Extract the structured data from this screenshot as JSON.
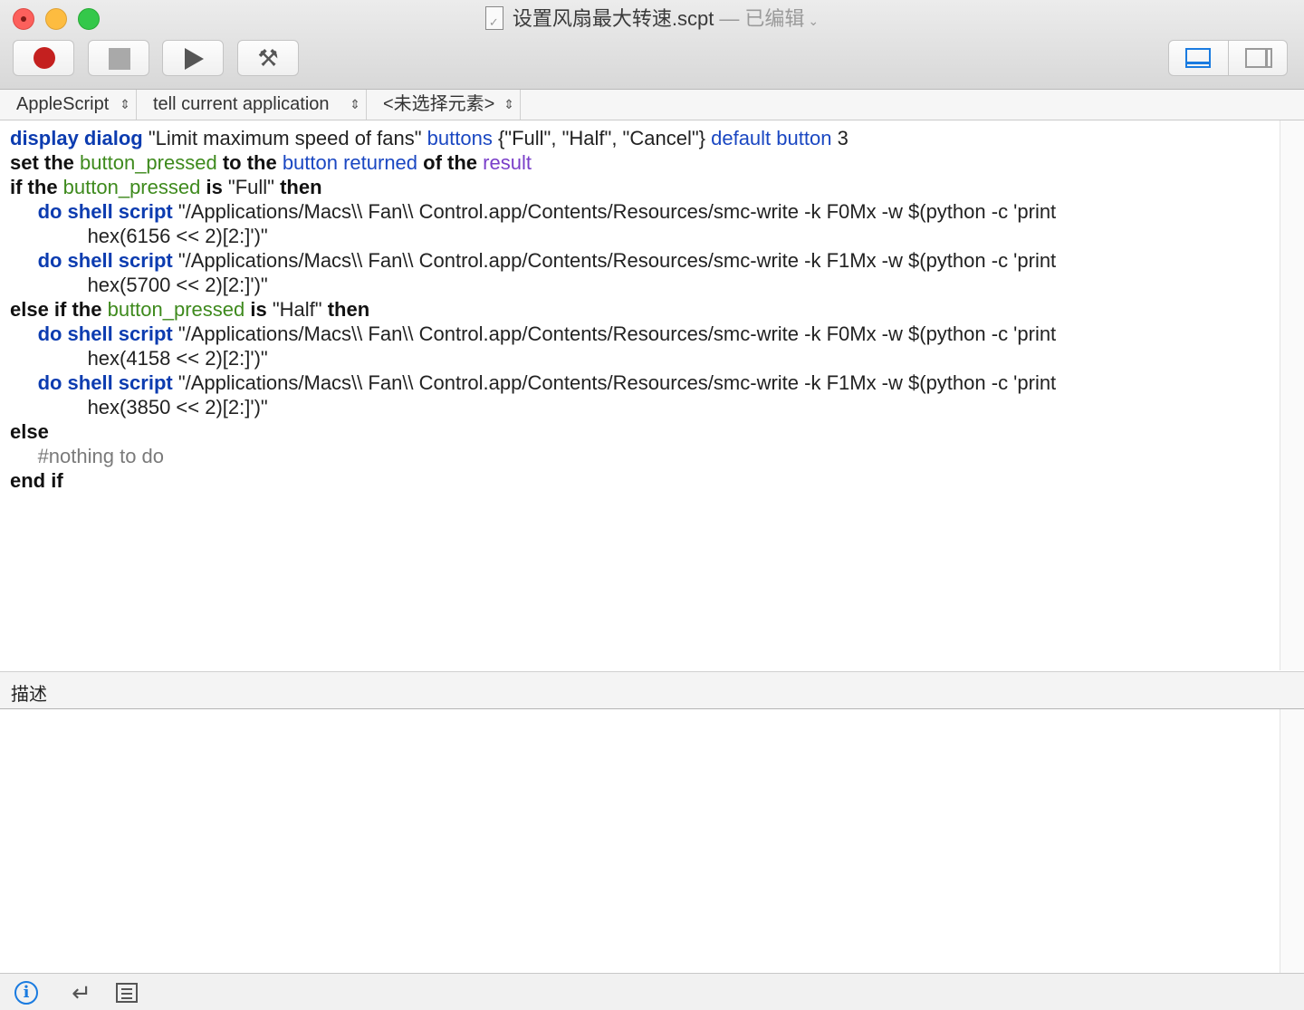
{
  "window": {
    "title": "设置风扇最大转速.scpt",
    "separator": "—",
    "status": "已编辑",
    "chevron": "⌄"
  },
  "toolbar": {
    "record": "record-button",
    "stop": "stop-button",
    "run": "run-button",
    "compile_icon": "⚒"
  },
  "navbar": {
    "language": "AppleScript",
    "target": "tell current application",
    "element": "<未选择元素>",
    "updown": "⇕"
  },
  "editor": {
    "lines": [
      [
        {
          "t": "display dialog",
          "c": "b"
        },
        {
          "t": " \"Limit maximum speed of fans\" ",
          "c": ""
        },
        {
          "t": "buttons",
          "c": "cls"
        },
        {
          "t": " {\"Full\", \"Half\", \"Cancel\"} ",
          "c": ""
        },
        {
          "t": "default button",
          "c": "cls"
        },
        {
          "t": " 3",
          "c": ""
        }
      ],
      [
        {
          "t": "set the ",
          "c": "k"
        },
        {
          "t": "button_pressed",
          "c": "var"
        },
        {
          "t": " to the ",
          "c": "k"
        },
        {
          "t": "button returned",
          "c": "cls"
        },
        {
          "t": " of the ",
          "c": "k"
        },
        {
          "t": "result",
          "c": "prop"
        }
      ],
      [
        {
          "t": "if the ",
          "c": "k"
        },
        {
          "t": "button_pressed",
          "c": "var"
        },
        {
          "t": " is ",
          "c": "k"
        },
        {
          "t": "\"Full\" ",
          "c": ""
        },
        {
          "t": "then",
          "c": "k"
        }
      ],
      [
        {
          "t": "     ",
          "c": ""
        },
        {
          "t": "do shell script",
          "c": "b"
        },
        {
          "t": " \"/Applications/Macs\\\\ Fan\\\\ Control.app/Contents/Resources/smc-write -k F0Mx -w $(python -c 'print",
          "c": ""
        }
      ],
      [
        {
          "t": "              hex(6156 << 2)[2:]')\"",
          "c": ""
        }
      ],
      [
        {
          "t": "     ",
          "c": ""
        },
        {
          "t": "do shell script",
          "c": "b"
        },
        {
          "t": " \"/Applications/Macs\\\\ Fan\\\\ Control.app/Contents/Resources/smc-write -k F1Mx -w $(python -c 'print",
          "c": ""
        }
      ],
      [
        {
          "t": "              hex(5700 << 2)[2:]')\"",
          "c": ""
        }
      ],
      [
        {
          "t": "else if the ",
          "c": "k"
        },
        {
          "t": "button_pressed",
          "c": "var"
        },
        {
          "t": " is ",
          "c": "k"
        },
        {
          "t": "\"Half\" ",
          "c": ""
        },
        {
          "t": "then",
          "c": "k"
        }
      ],
      [
        {
          "t": "     ",
          "c": ""
        },
        {
          "t": "do shell script",
          "c": "b"
        },
        {
          "t": " \"/Applications/Macs\\\\ Fan\\\\ Control.app/Contents/Resources/smc-write -k F0Mx -w $(python -c 'print",
          "c": ""
        }
      ],
      [
        {
          "t": "              hex(4158 << 2)[2:]')\"",
          "c": ""
        }
      ],
      [
        {
          "t": "     ",
          "c": ""
        },
        {
          "t": "do shell script",
          "c": "b"
        },
        {
          "t": " \"/Applications/Macs\\\\ Fan\\\\ Control.app/Contents/Resources/smc-write -k F1Mx -w $(python -c 'print",
          "c": ""
        }
      ],
      [
        {
          "t": "              hex(3850 << 2)[2:]')\"",
          "c": ""
        }
      ],
      [
        {
          "t": "else",
          "c": "k"
        }
      ],
      [
        {
          "t": "     ",
          "c": ""
        },
        {
          "t": "#nothing to do",
          "c": "cmt"
        }
      ],
      [
        {
          "t": "end if",
          "c": "k"
        }
      ]
    ]
  },
  "description": {
    "label": "描述"
  },
  "bottombar": {
    "info_icon": "i",
    "return_icon": "↵"
  },
  "colors": {
    "keyword": "#111111",
    "command": "#0c3cb0",
    "class": "#1a47c2",
    "variable": "#3e8a1d",
    "property": "#7a3fc9",
    "comment": "#7a7a7a",
    "accent": "#1a7be0"
  }
}
